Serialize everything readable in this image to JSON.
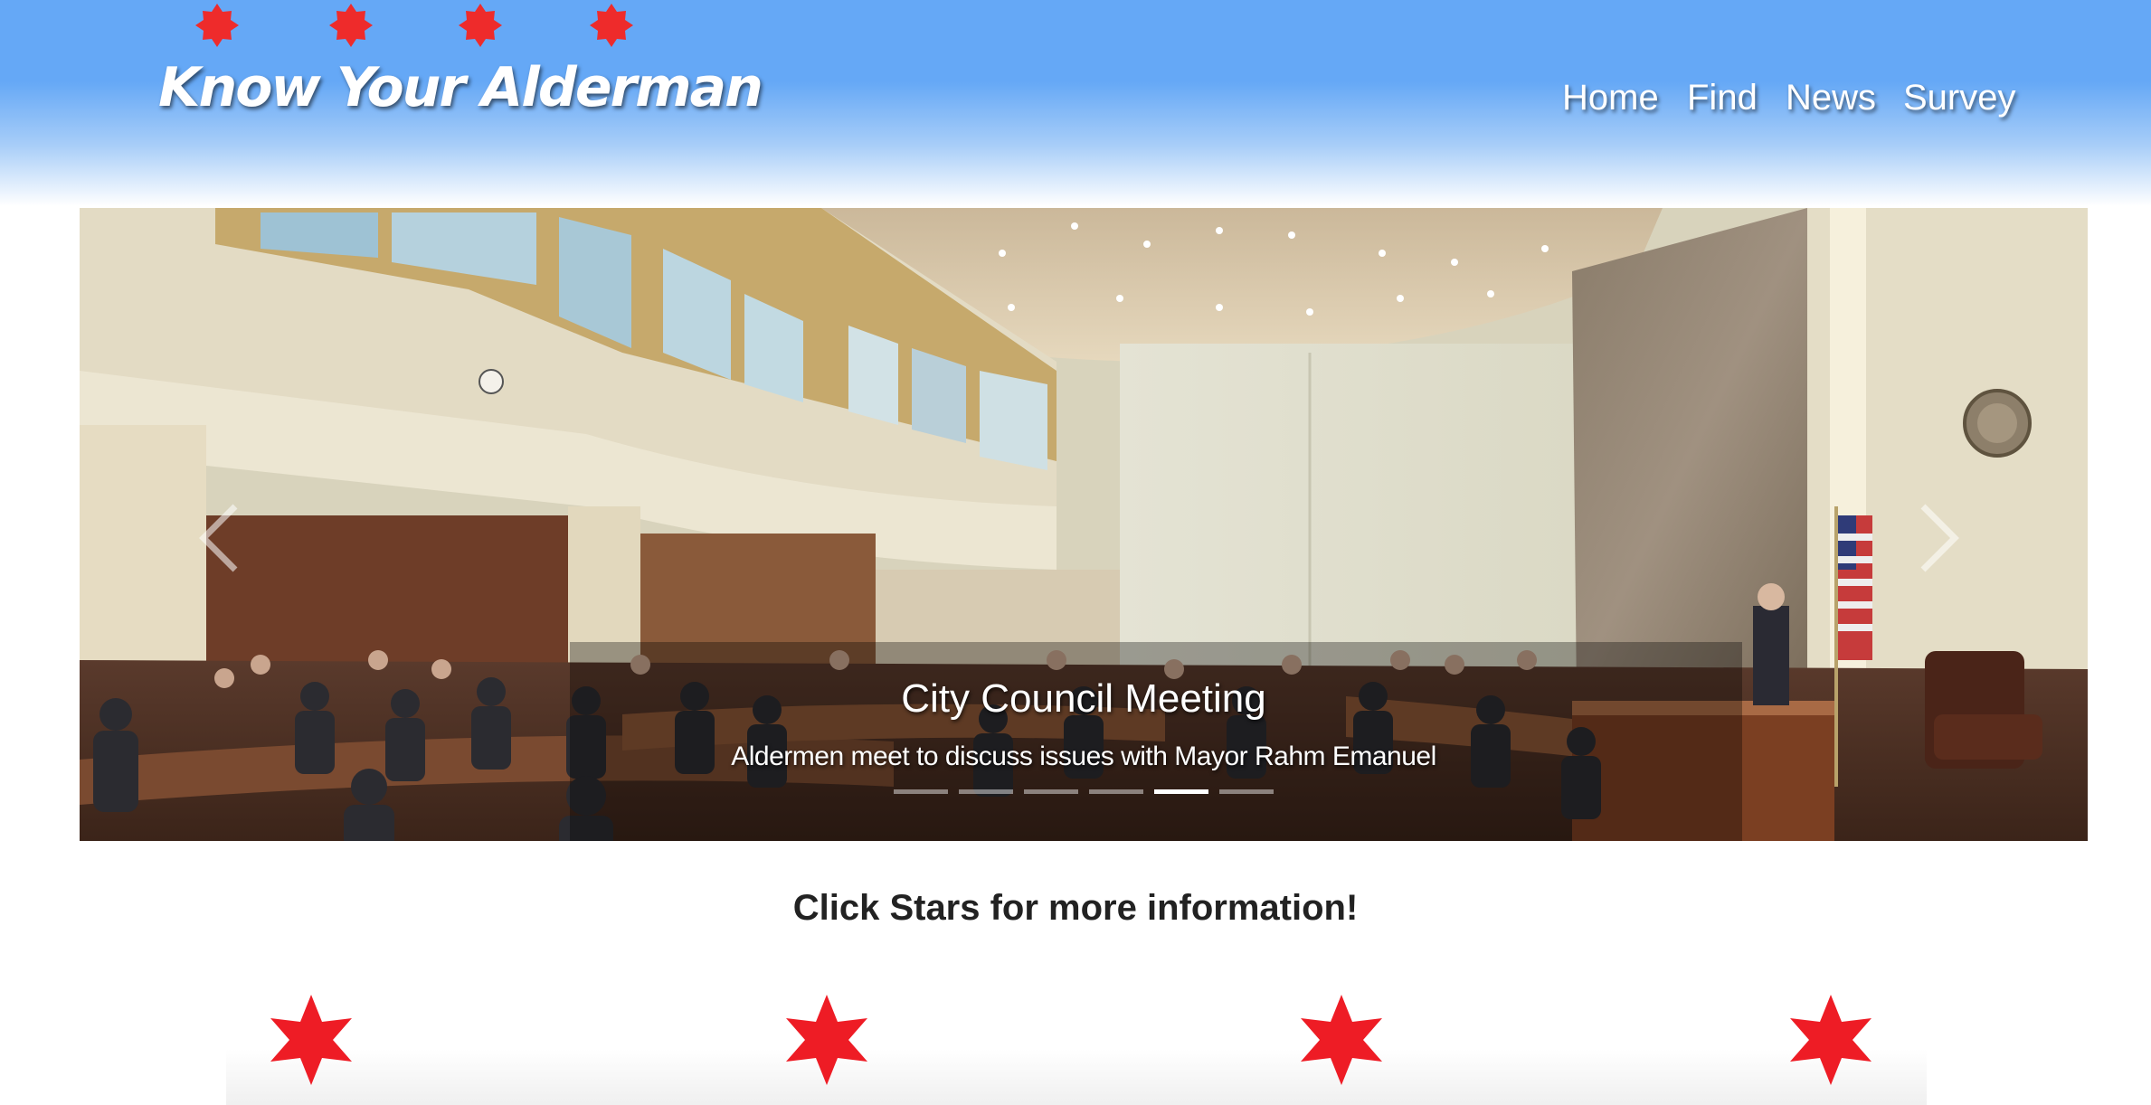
{
  "header": {
    "title": "Know Your Alderman",
    "background_color": "#65a8f6",
    "decorative_star_icon": "six-pointed-star-icon",
    "decorative_star_color": "#ee2b2b"
  },
  "nav": {
    "items": [
      {
        "label": "Home"
      },
      {
        "label": "Find"
      },
      {
        "label": "News"
      },
      {
        "label": "Survey"
      }
    ]
  },
  "carousel": {
    "slide_title": "City Council Meeting",
    "slide_caption": "Aldermen meet to discuss issues with Mayor Rahm Emanuel",
    "slide_count": 6,
    "active_slide_index": 4,
    "prev_icon": "chevron-left-icon",
    "next_icon": "chevron-right-icon"
  },
  "stars_section": {
    "prompt": "Click Stars for more information!",
    "star_icon": "six-pointed-star-icon",
    "star_color": "#ee1c25",
    "star_count": 4
  }
}
